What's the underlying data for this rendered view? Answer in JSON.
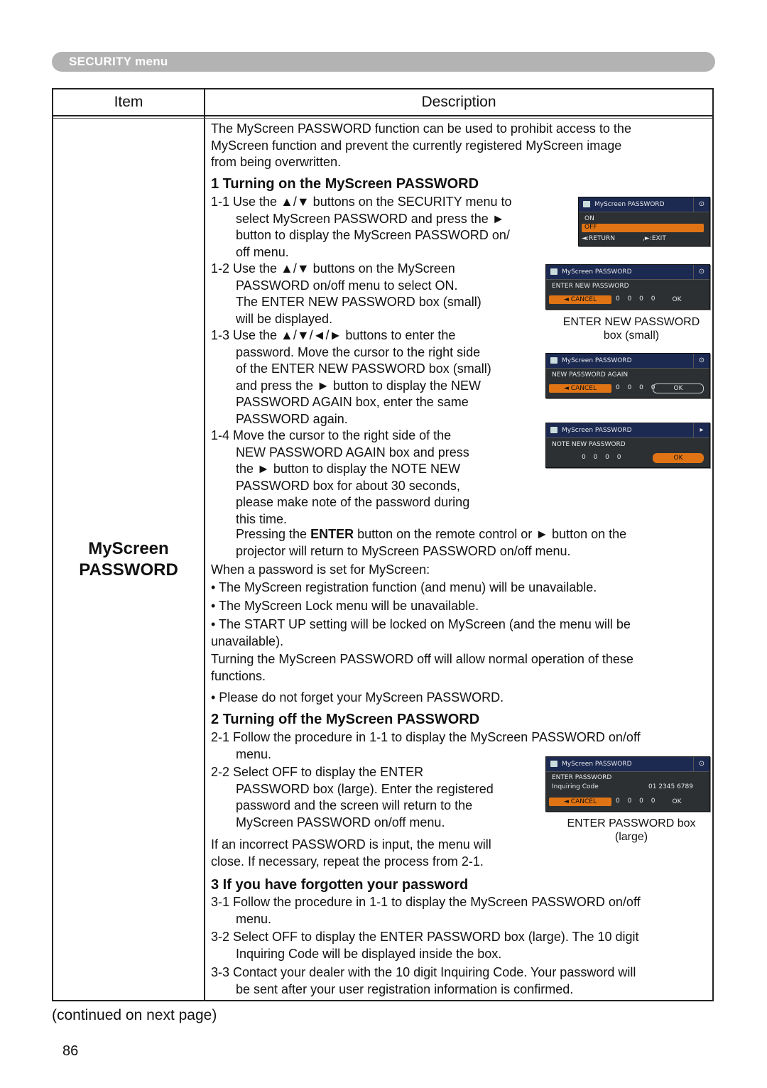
{
  "banner": {
    "label": "SECURITY menu"
  },
  "table": {
    "headers": {
      "item": "Item",
      "description": "Description"
    },
    "item_name": [
      "MyScreen",
      "PASSWORD"
    ]
  },
  "intro": [
    "The MyScreen PASSWORD function can be used to prohibit access to the",
    "MyScreen function and prevent the currently registered MyScreen image",
    "from being overwritten."
  ],
  "section1": {
    "heading": "1 Turning on the MyScreen PASSWORD",
    "step1_1": [
      "1-1 Use the ▲/▼ buttons on the SECURITY menu to",
      "select MyScreen PASSWORD and press the ►",
      "button to display the MyScreen PASSWORD on/",
      "off menu."
    ],
    "step1_2": [
      "1-2 Use the ▲/▼ buttons on the MyScreen",
      "PASSWORD on/off menu to select ON.",
      "The ENTER NEW PASSWORD box (small)",
      "will be displayed."
    ],
    "step1_3": [
      "1-3 Use the ▲/▼/◄/► buttons to enter the",
      "password. Move the cursor to the right side",
      "of the ENTER NEW PASSWORD box (small)",
      "and press the ► button to display the NEW",
      "PASSWORD AGAIN box, enter the same",
      "PASSWORD again."
    ],
    "step1_4": [
      "1-4 Move the cursor to the right side of the",
      "NEW PASSWORD AGAIN box and press",
      "the ► button to display the NOTE NEW",
      "PASSWORD box for about 30 seconds,",
      "please make note of the password during",
      "this time."
    ],
    "enter_note": {
      "pre": "Pressing the ",
      "bold": "ENTER",
      "post": " button on the remote control or ► button on the",
      "line2": "projector will return to MyScreen PASSWORD on/off menu."
    },
    "when_set": "When a password is set for MyScreen:",
    "bullets": [
      "• The MyScreen registration function (and menu) will be unavailable.",
      "• The MyScreen Lock menu will be unavailable.",
      "• The START UP setting will be locked on MyScreen (and the menu will be",
      "unavailable)."
    ],
    "turning_off_note": [
      "Turning the MyScreen PASSWORD off will allow normal operation of these",
      "functions."
    ],
    "reminder": "• Please do not forget your MyScreen PASSWORD."
  },
  "section2": {
    "heading": "2 Turning off the MyScreen PASSWORD",
    "step2_1": [
      "2-1 Follow the procedure in 1-1 to display the MyScreen PASSWORD on/off",
      "menu."
    ],
    "step2_2": [
      "2-2 Select OFF to display the ENTER",
      "PASSWORD box (large). Enter the registered",
      "password and the screen will return to the",
      "MyScreen PASSWORD on/off menu."
    ],
    "incorrect": [
      "If an incorrect PASSWORD is input, the menu will",
      "close. If necessary, repeat the process from 2-1."
    ]
  },
  "section3": {
    "heading": "3 If you have forgotten your password",
    "step3_1": [
      "3-1 Follow the procedure in 1-1 to display the MyScreen PASSWORD on/off",
      "menu."
    ],
    "step3_2": [
      "3-2 Select OFF to display the ENTER PASSWORD box (large). The 10 digit",
      "Inquiring Code will be displayed inside the box."
    ],
    "step3_3": [
      "3-3 Contact your dealer with the 10 digit Inquiring Code. Your password will",
      "be sent after your user registration information is confirmed."
    ]
  },
  "osd": {
    "title": "MyScreen PASSWORD",
    "onoff": {
      "on": "ON",
      "off": "OFF",
      "return": "◄:RETURN",
      "exit": ",►:EXIT"
    },
    "enter_new": {
      "label": "ENTER NEW PASSWORD",
      "cancel": "◄  CANCEL",
      "digits": "0 0 0 0",
      "ok": "OK"
    },
    "again": {
      "label": "NEW PASSWORD AGAIN",
      "cancel": "◄  CANCEL",
      "digits": "0 0 0 0",
      "ok": "OK"
    },
    "note": {
      "label": "NOTE NEW PASSWORD",
      "digits": "0 0 0 0",
      "ok": "OK"
    },
    "enter": {
      "label": "ENTER PASSWORD",
      "inq_label": "Inquiring Code",
      "inq_code": "01 2345 6789",
      "cancel": "◄  CANCEL",
      "digits": "0 0 0 0",
      "ok": "OK"
    }
  },
  "captions": {
    "small": [
      "ENTER NEW PASSWORD",
      "box (small)"
    ],
    "large": [
      "ENTER PASSWORD box",
      "(large)"
    ]
  },
  "footer": {
    "continued": "(continued on next page)",
    "page_number": "86"
  }
}
